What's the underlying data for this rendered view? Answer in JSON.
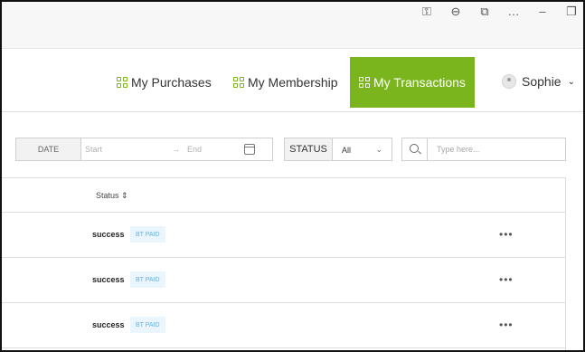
{
  "browser": {
    "icons": [
      "key-icon",
      "zoom-out-icon",
      "extension-icon",
      "more-icon",
      "minimize-icon",
      "restore-icon",
      "close-icon"
    ]
  },
  "nav": {
    "purchases": "My Purchases",
    "membership": "My Membership",
    "transactions": "My Transactions",
    "user": "Sophie",
    "active_color": "#7ab51d"
  },
  "filters": {
    "date_label": "DATE",
    "start_placeholder": "Start",
    "separator": "→",
    "end_placeholder": "End",
    "status_label": "STATUS",
    "status_value": "All",
    "search_placeholder": "Type here..."
  },
  "table": {
    "columns": [
      "Status"
    ],
    "sort_icon": "⇕",
    "rows": [
      {
        "status": "success",
        "badge": "BT PAID",
        "action": "•••"
      },
      {
        "status": "success",
        "badge": "BT PAID",
        "action": "•••"
      },
      {
        "status": "success",
        "badge": "BT PAID",
        "action": "•••"
      }
    ]
  }
}
